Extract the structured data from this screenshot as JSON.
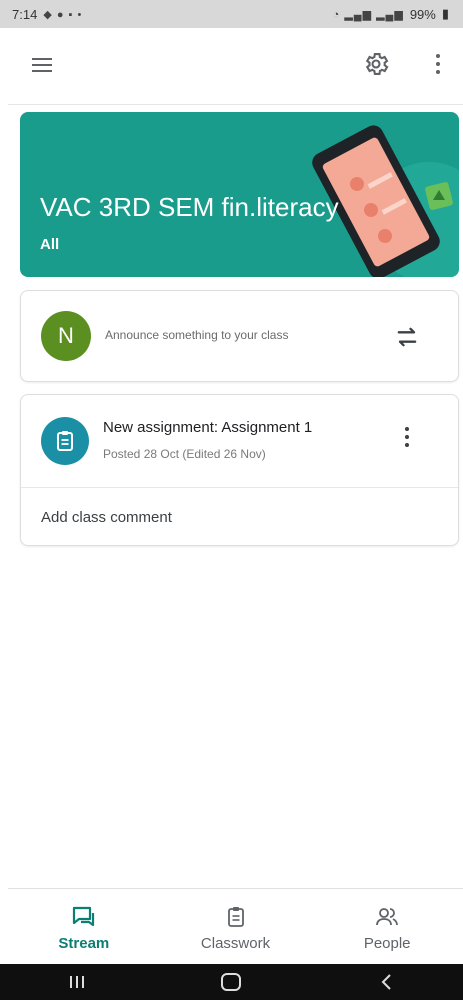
{
  "status": {
    "time": "7:14",
    "battery": "99%"
  },
  "banner": {
    "title": "VAC 3RD SEM fin.literacy",
    "subtitle": "All",
    "color": "#1a9c8c"
  },
  "announce": {
    "avatar_letter": "N",
    "placeholder": "Announce something to your class"
  },
  "assignment": {
    "title": "New assignment: Assignment 1",
    "meta": "Posted 28 Oct (Edited 26 Nov)",
    "comment_label": "Add class comment"
  },
  "nav": {
    "items": [
      {
        "label": "Stream",
        "icon": "stream-icon"
      },
      {
        "label": "Classwork",
        "icon": "classwork-icon"
      },
      {
        "label": "People",
        "icon": "people-icon"
      }
    ],
    "active": "Stream",
    "accent": "#0b7f73"
  }
}
